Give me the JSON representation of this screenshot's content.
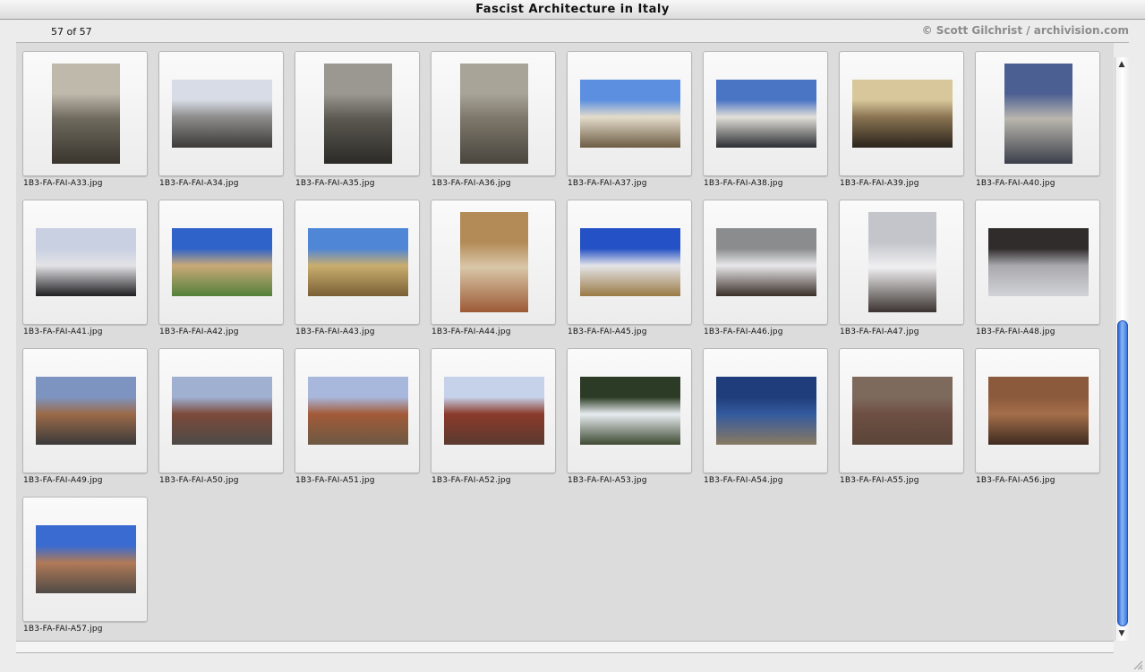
{
  "window": {
    "title": "Fascist Architecture in Italy"
  },
  "info": {
    "count": "57 of 57",
    "copyright": "© Scott Gilchrist / archivision.com"
  },
  "thumbnails": [
    {
      "file": "1B3-FA-FAI-A33.jpg",
      "orient": "portrait",
      "colors": [
        "#bfb9ac",
        "#6f6a5e",
        "#3a352d"
      ]
    },
    {
      "file": "1B3-FA-FAI-A34.jpg",
      "orient": "landscape",
      "colors": [
        "#d7dce6",
        "#8e8d8c",
        "#3c3a38"
      ]
    },
    {
      "file": "1B3-FA-FAI-A35.jpg",
      "orient": "portrait",
      "colors": [
        "#9a9890",
        "#5b5951",
        "#2b2a27"
      ]
    },
    {
      "file": "1B3-FA-FAI-A36.jpg",
      "orient": "portrait",
      "colors": [
        "#a9a498",
        "#7d776b",
        "#4a463e"
      ]
    },
    {
      "file": "1B3-FA-FAI-A37.jpg",
      "orient": "landscape",
      "colors": [
        "#5c8fe0",
        "#e3dccb",
        "#6d5c44"
      ]
    },
    {
      "file": "1B3-FA-FAI-A38.jpg",
      "orient": "landscape",
      "colors": [
        "#4a74c4",
        "#e2e0d8",
        "#2b2d33"
      ]
    },
    {
      "file": "1B3-FA-FAI-A39.jpg",
      "orient": "landscape",
      "colors": [
        "#d8c79a",
        "#8a7453",
        "#2a241b"
      ]
    },
    {
      "file": "1B3-FA-FAI-A40.jpg",
      "orient": "portrait",
      "colors": [
        "#4c5f92",
        "#b9b6ae",
        "#3b3f4a"
      ]
    },
    {
      "file": "1B3-FA-FAI-A41.jpg",
      "orient": "landscape",
      "colors": [
        "#c9d0e2",
        "#e3e3e6",
        "#1f1f22"
      ]
    },
    {
      "file": "1B3-FA-FAI-A42.jpg",
      "orient": "landscape",
      "colors": [
        "#2f63c9",
        "#c9a978",
        "#53813a"
      ]
    },
    {
      "file": "1B3-FA-FAI-A43.jpg",
      "orient": "landscape",
      "colors": [
        "#4f86d6",
        "#c9ae6e",
        "#7a5f35"
      ]
    },
    {
      "file": "1B3-FA-FAI-A44.jpg",
      "orient": "portrait",
      "colors": [
        "#b38b57",
        "#d9c7a8",
        "#9c5a36"
      ]
    },
    {
      "file": "1B3-FA-FAI-A45.jpg",
      "orient": "landscape",
      "colors": [
        "#2451c5",
        "#e4e4e8",
        "#9a7a45"
      ]
    },
    {
      "file": "1B3-FA-FAI-A46.jpg",
      "orient": "landscape",
      "colors": [
        "#8a8c8e",
        "#e8e8ea",
        "#3a2e27"
      ]
    },
    {
      "file": "1B3-FA-FAI-A47.jpg",
      "orient": "portrait",
      "colors": [
        "#c3c5cb",
        "#f0f0f2",
        "#3b3330"
      ]
    },
    {
      "file": "1B3-FA-FAI-A48.jpg",
      "orient": "landscape",
      "colors": [
        "#2f2c2b",
        "#a8a8ad",
        "#d2d3d8"
      ]
    },
    {
      "file": "1B3-FA-FAI-A49.jpg",
      "orient": "landscape",
      "colors": [
        "#7e94c0",
        "#9b6a48",
        "#3a3a3a"
      ]
    },
    {
      "file": "1B3-FA-FAI-A50.jpg",
      "orient": "landscape",
      "colors": [
        "#9fb0d1",
        "#7c4a3a",
        "#4d4a48"
      ]
    },
    {
      "file": "1B3-FA-FAI-A51.jpg",
      "orient": "landscape",
      "colors": [
        "#a8b7dc",
        "#a35a38",
        "#6c5944"
      ]
    },
    {
      "file": "1B3-FA-FAI-A52.jpg",
      "orient": "landscape",
      "colors": [
        "#c6d2ea",
        "#8b3a2a",
        "#5a3a30"
      ]
    },
    {
      "file": "1B3-FA-FAI-A53.jpg",
      "orient": "landscape",
      "colors": [
        "#2c3b25",
        "#e8ecf0",
        "#3e4a33"
      ]
    },
    {
      "file": "1B3-FA-FAI-A54.jpg",
      "orient": "landscape",
      "colors": [
        "#1f3d7a",
        "#335a9e",
        "#8a7a62"
      ]
    },
    {
      "file": "1B3-FA-FAI-A55.jpg",
      "orient": "landscape",
      "colors": [
        "#7d6a5c",
        "#6e4f43",
        "#5a4438"
      ]
    },
    {
      "file": "1B3-FA-FAI-A56.jpg",
      "orient": "landscape",
      "colors": [
        "#8b5a3c",
        "#a46e4a",
        "#3d2a1f"
      ]
    },
    {
      "file": "1B3-FA-FAI-A57.jpg",
      "orient": "landscape",
      "colors": [
        "#3a6bd0",
        "#b07a58",
        "#4f4a45"
      ]
    }
  ],
  "colors": {
    "window_bg": "#ececec",
    "content_bg": "#dcdcdc",
    "scroll_thumb": "#3b76e0",
    "copyright_text": "#8c8c8c"
  }
}
